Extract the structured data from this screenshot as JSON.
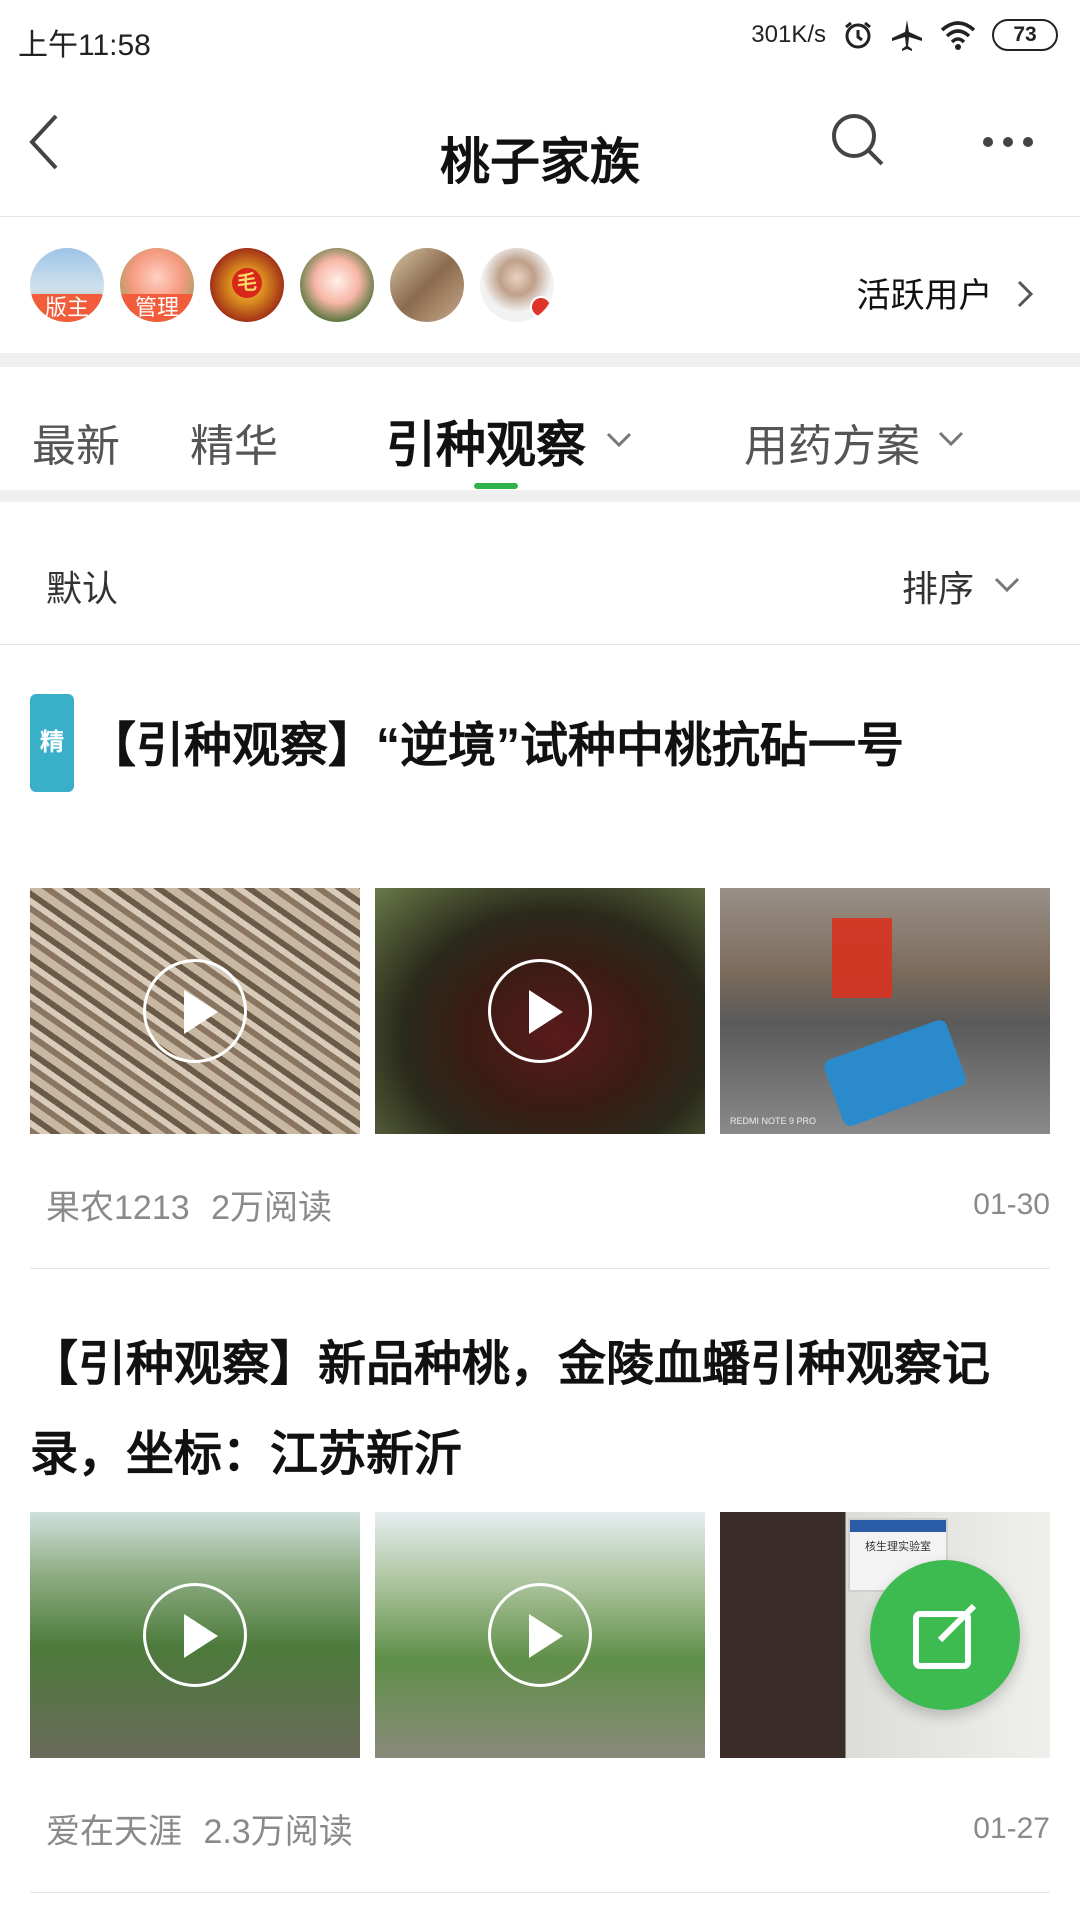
{
  "status": {
    "time": "上午11:58",
    "net_speed": "301K/s",
    "battery": "73",
    "icons": [
      "alarm-icon",
      "airplane-icon",
      "wifi-icon",
      "battery-icon"
    ]
  },
  "nav": {
    "title": "桃子家族",
    "icons": [
      "back-icon",
      "search-icon",
      "more-icon"
    ]
  },
  "members": {
    "badge_owner": "版主",
    "badge_admin": "管理",
    "badge_mao": "毛",
    "active_users": "活跃用户"
  },
  "tabs": [
    {
      "label": "最新"
    },
    {
      "label": "精华"
    },
    {
      "label": "引种观察"
    },
    {
      "label": "用药方案"
    }
  ],
  "sort": {
    "default_label": "默认",
    "sort_label": "排序"
  },
  "posts": [
    {
      "badge": "精",
      "title": "【引种观察】“逆境”试种中桃抗砧一号",
      "author": "果农1213",
      "reads": "2万阅读",
      "date": "01-30",
      "watermark": "REDMI NOTE 9 PRO"
    },
    {
      "title": "【引种观察】新品种桃，金陵血蟠引种观察记录，坐标：江苏新沂",
      "author": "爱在天涯",
      "reads": "2.3万阅读",
      "date": "01-27",
      "sign_text": "核生理实验室"
    }
  ],
  "colors": {
    "accent": "#2db34a",
    "fab": "#3dbb50",
    "badge_red": "#f25c3a",
    "badge_jing": "#39b0c8"
  }
}
